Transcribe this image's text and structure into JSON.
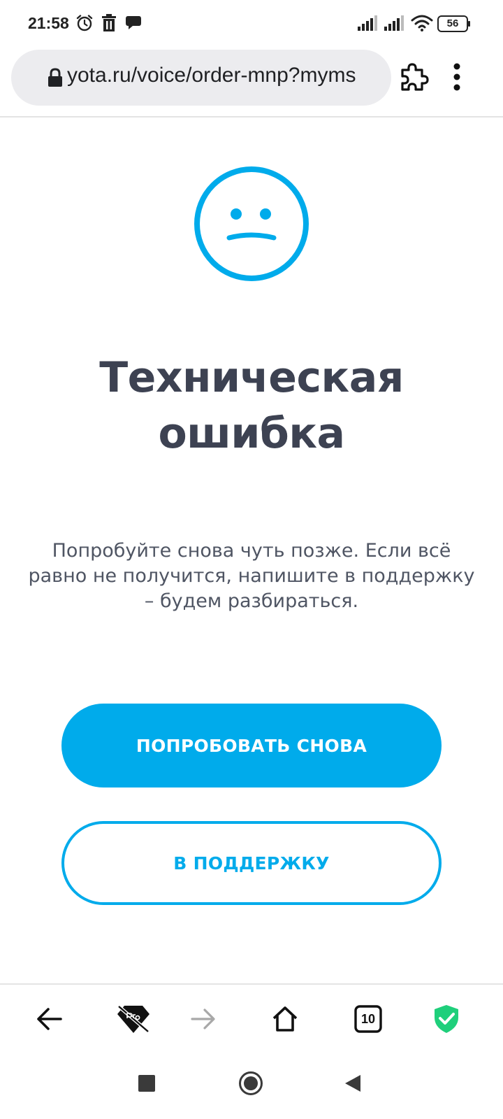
{
  "status_bar": {
    "time": "21:58",
    "battery": "56",
    "icons": [
      "alarm-icon",
      "trash-icon",
      "chat-icon",
      "signal-icon",
      "signal-icon",
      "wifi-icon",
      "battery-icon"
    ]
  },
  "browser": {
    "url": "yota.ru/voice/order-mnp?myms",
    "icons": [
      "lock-icon",
      "extension-icon",
      "more-vert-icon"
    ]
  },
  "error_page": {
    "icon": "sad-face-icon",
    "title_line1": "Техническая",
    "title_line2": "ошибка",
    "description": "Попробуйте снова чуть позже. Если всё равно не получится, напишите в поддержку – будем разбираться.",
    "retry_button": "ПОПРОБОВАТЬ СНОВА",
    "support_button": "В ПОДДЕРЖКУ"
  },
  "toolbar": {
    "tabs_count": "10",
    "icons": [
      "back-arrow-icon",
      "pro-diamond-icon",
      "forward-arrow-icon",
      "home-icon",
      "tabs-icon",
      "shield-check-icon"
    ]
  },
  "nav": {
    "icons": [
      "recents-square-icon",
      "home-circle-icon",
      "back-triangle-icon"
    ]
  },
  "colors": {
    "accent": "#00abeb",
    "title": "#3d4252",
    "text": "#4f5563",
    "shield": "#1fcf7b"
  }
}
